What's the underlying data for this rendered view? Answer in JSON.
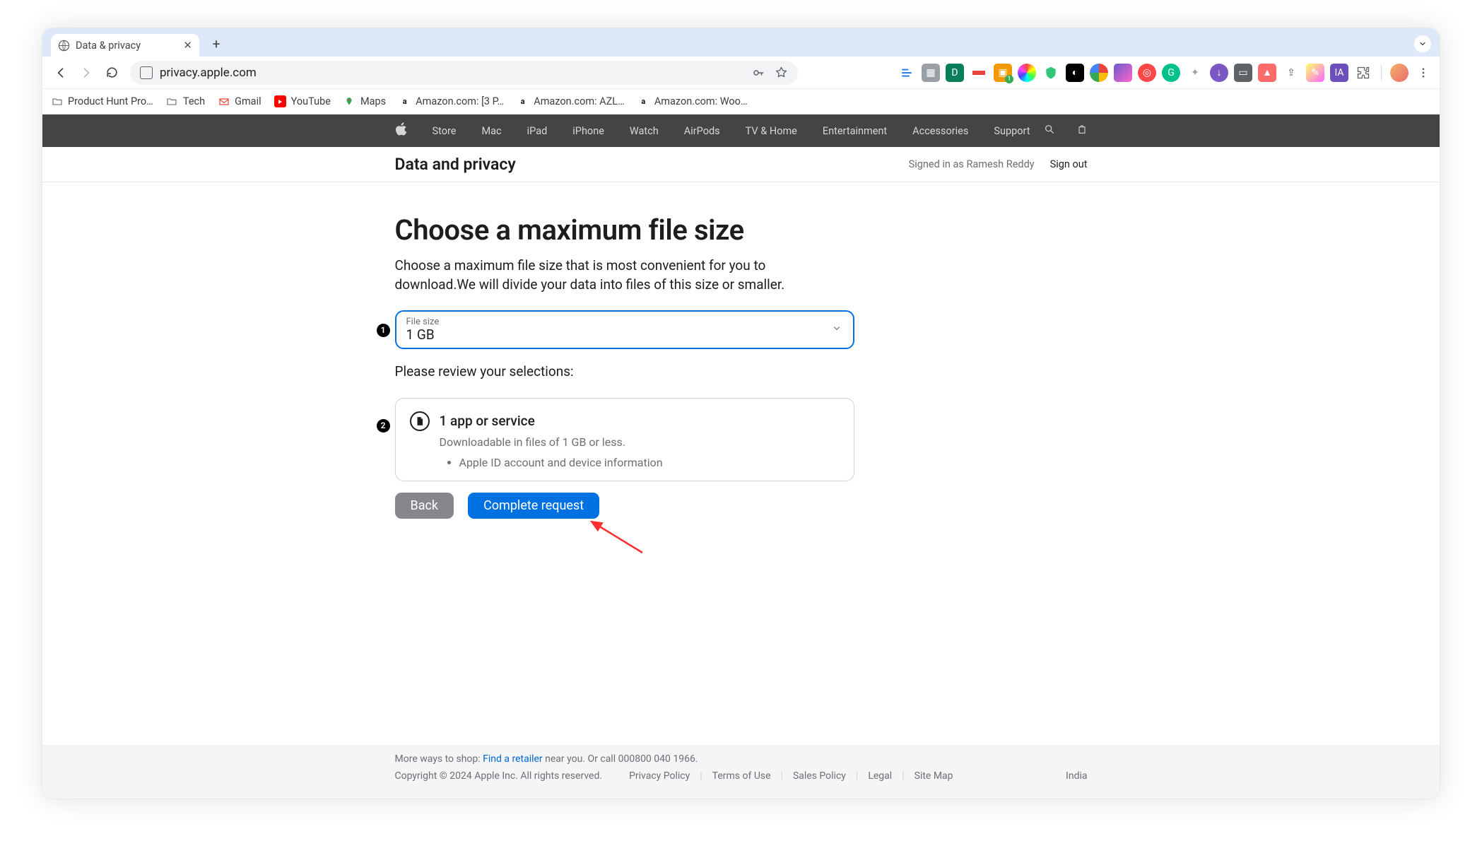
{
  "browser": {
    "tab_title": "Data & privacy",
    "url": "privacy.apple.com",
    "bookmarks": [
      "Product Hunt Pro…",
      "Tech",
      "Gmail",
      "YouTube",
      "Maps",
      "Amazon.com: [3 P…",
      "Amazon.com: AZL…",
      "Amazon.com: Woo…"
    ]
  },
  "globalnav": [
    "Store",
    "Mac",
    "iPad",
    "iPhone",
    "Watch",
    "AirPods",
    "TV & Home",
    "Entertainment",
    "Accessories",
    "Support"
  ],
  "localnav": {
    "title": "Data and privacy",
    "signed_in": "Signed in as Ramesh Reddy",
    "signout": "Sign out"
  },
  "page": {
    "title": "Choose a maximum file size",
    "lead": "Choose a maximum file size that is most convenient for you to download.We will divide your data into files of this size or smaller.",
    "select_label": "File size",
    "select_value": "1 GB",
    "review_heading": "Please review your selections:",
    "card": {
      "apps": "1 app or service",
      "sub": "Downloadable in files of 1 GB or less.",
      "items": [
        "Apple ID account and device information"
      ]
    },
    "back": "Back",
    "complete": "Complete request"
  },
  "annotations": {
    "one": "1",
    "two": "2"
  },
  "footer": {
    "shop_pre": "More ways to shop: ",
    "retailer": "Find a retailer",
    "shop_post": " near you. Or call 000800 040 1966.",
    "copyright": "Copyright © 2024 Apple Inc. All rights reserved.",
    "links": [
      "Privacy Policy",
      "Terms of Use",
      "Sales Policy",
      "Legal",
      "Site Map"
    ],
    "country": "India"
  }
}
